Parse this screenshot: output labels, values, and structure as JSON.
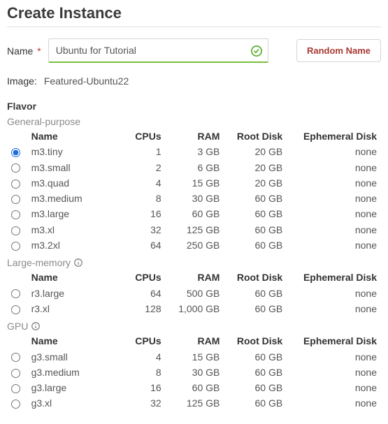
{
  "title": "Create Instance",
  "name_field": {
    "label": "Name",
    "required_mark": "*",
    "value": "Ubuntu for Tutorial"
  },
  "random_button_label": "Random Name",
  "image_field": {
    "label": "Image:",
    "value": "Featured-Ubuntu22"
  },
  "flavor_section_label": "Flavor",
  "columns": {
    "name": "Name",
    "cpus": "CPUs",
    "ram": "RAM",
    "root": "Root Disk",
    "eph": "Ephemeral Disk"
  },
  "groups": [
    {
      "label": "General-purpose",
      "info": false,
      "rows": [
        {
          "name": "m3.tiny",
          "cpus": "1",
          "ram": "3 GB",
          "root": "20 GB",
          "eph": "none",
          "selected": true
        },
        {
          "name": "m3.small",
          "cpus": "2",
          "ram": "6 GB",
          "root": "20 GB",
          "eph": "none",
          "selected": false
        },
        {
          "name": "m3.quad",
          "cpus": "4",
          "ram": "15 GB",
          "root": "20 GB",
          "eph": "none",
          "selected": false
        },
        {
          "name": "m3.medium",
          "cpus": "8",
          "ram": "30 GB",
          "root": "60 GB",
          "eph": "none",
          "selected": false
        },
        {
          "name": "m3.large",
          "cpus": "16",
          "ram": "60 GB",
          "root": "60 GB",
          "eph": "none",
          "selected": false
        },
        {
          "name": "m3.xl",
          "cpus": "32",
          "ram": "125 GB",
          "root": "60 GB",
          "eph": "none",
          "selected": false
        },
        {
          "name": "m3.2xl",
          "cpus": "64",
          "ram": "250 GB",
          "root": "60 GB",
          "eph": "none",
          "selected": false
        }
      ]
    },
    {
      "label": "Large-memory",
      "info": true,
      "rows": [
        {
          "name": "r3.large",
          "cpus": "64",
          "ram": "500 GB",
          "root": "60 GB",
          "eph": "none",
          "selected": false
        },
        {
          "name": "r3.xl",
          "cpus": "128",
          "ram": "1,000 GB",
          "root": "60 GB",
          "eph": "none",
          "selected": false
        }
      ]
    },
    {
      "label": "GPU",
      "info": true,
      "rows": [
        {
          "name": "g3.small",
          "cpus": "4",
          "ram": "15 GB",
          "root": "60 GB",
          "eph": "none",
          "selected": false
        },
        {
          "name": "g3.medium",
          "cpus": "8",
          "ram": "30 GB",
          "root": "60 GB",
          "eph": "none",
          "selected": false
        },
        {
          "name": "g3.large",
          "cpus": "16",
          "ram": "60 GB",
          "root": "60 GB",
          "eph": "none",
          "selected": false
        },
        {
          "name": "g3.xl",
          "cpus": "32",
          "ram": "125 GB",
          "root": "60 GB",
          "eph": "none",
          "selected": false
        }
      ]
    }
  ]
}
